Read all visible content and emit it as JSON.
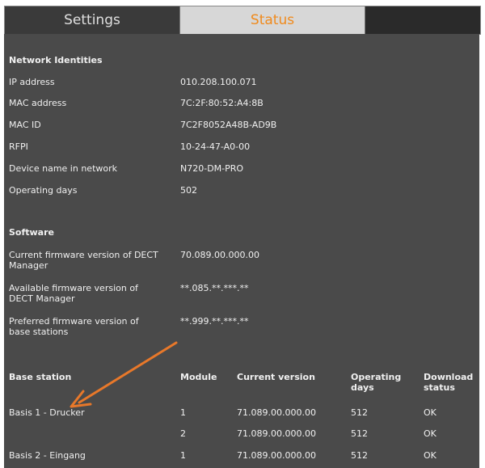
{
  "tabs": {
    "settings": "Settings",
    "status": "Status"
  },
  "network": {
    "heading": "Network Identities",
    "rows": [
      {
        "label": "IP address",
        "value": "010.208.100.071"
      },
      {
        "label": "MAC address",
        "value": "7C:2F:80:52:A4:8B"
      },
      {
        "label": "MAC ID",
        "value": "7C2F8052A48B-AD9B"
      },
      {
        "label": "RFPI",
        "value": "10-24-47-A0-00"
      },
      {
        "label": "Device name in network",
        "value": "N720-DM-PRO"
      },
      {
        "label": "Operating days",
        "value": "502"
      }
    ]
  },
  "software": {
    "heading": "Software",
    "rows": [
      {
        "label": "Current firmware version of DECT Manager",
        "value": "70.089.00.000.00"
      },
      {
        "label": "Available firmware version of DECT Manager",
        "value": "**.085.**.***.**"
      },
      {
        "label": "Preferred firmware version of base stations",
        "value": "**.999.**.***.**"
      }
    ]
  },
  "base_table": {
    "headers": [
      "Base station",
      "Module",
      "Current version",
      "Operating days",
      "Download status"
    ],
    "rows": [
      {
        "station": "Basis 1 - Drucker",
        "module": "1",
        "version": "71.089.00.000.00",
        "days": "512",
        "status": "OK"
      },
      {
        "station": "",
        "module": "2",
        "version": "71.089.00.000.00",
        "days": "512",
        "status": "OK"
      },
      {
        "station": "Basis 2 - Eingang",
        "module": "1",
        "version": "71.089.00.000.00",
        "days": "512",
        "status": "OK"
      }
    ]
  },
  "colors": {
    "panel": "#4a4a4a",
    "accent": "#f08a1c",
    "arrow": "#e8782a"
  },
  "annotation": {
    "icon": "arrow-icon"
  }
}
